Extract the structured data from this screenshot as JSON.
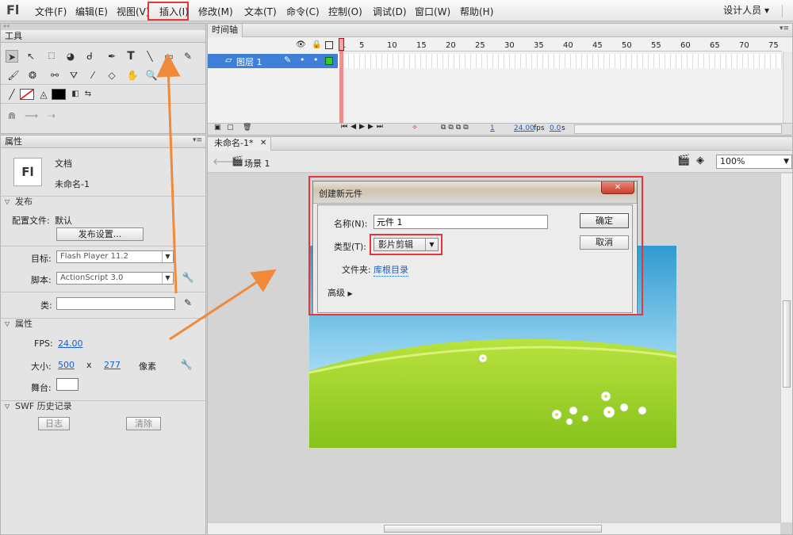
{
  "app": {
    "logo": "Fl",
    "workspace": "设计人员"
  },
  "menu": [
    "文件(F)",
    "编辑(E)",
    "视图(V)",
    "插入(I)",
    "修改(M)",
    "文本(T)",
    "命令(C)",
    "控制(O)",
    "调试(D)",
    "窗口(W)",
    "帮助(H)"
  ],
  "tools_panel": {
    "title": "工具"
  },
  "properties": {
    "title": "属性",
    "doc_type": "文档",
    "doc_name": "未命名-1",
    "doc_icon_text": "Fl",
    "publish_section": "发布",
    "profile_label": "配置文件:",
    "profile_value": "默认",
    "publish_settings_button": "发布设置...",
    "target_label": "目标:",
    "target_value": "Flash Player 11.2",
    "script_label": "脚本:",
    "script_value": "ActionScript 3.0",
    "class_label": "类:",
    "props_section": "属性",
    "fps_label": "FPS:",
    "fps_value": "24.00",
    "size_label": "大小:",
    "width_value": "500",
    "x_sep": "x",
    "height_value": "277",
    "unit": "像素",
    "stage_label": "舞台:",
    "swf_section": "SWF 历史记录",
    "log_button": "日志",
    "clear_button": "清除"
  },
  "timeline": {
    "tab": "时间轴",
    "layer_name": "图层 1",
    "frame_numbers": [
      "1",
      "5",
      "10",
      "15",
      "20",
      "25",
      "30",
      "35",
      "40",
      "45",
      "50",
      "55",
      "60",
      "65",
      "70",
      "75"
    ],
    "current_frame": "1",
    "fps": "24.00",
    "fps_unit": "fps",
    "time": "0.0",
    "time_unit": "s"
  },
  "document": {
    "tab": "未命名-1*",
    "scene": "场景 1",
    "zoom": "100%"
  },
  "dialog": {
    "title": "创建新元件",
    "name_label": "名称(N):",
    "name_value": "元件 1",
    "type_label": "类型(T):",
    "type_value": "影片剪辑",
    "folder_label": "文件夹:",
    "folder_value": "库根目录",
    "advanced": "高级",
    "ok_button": "确定",
    "cancel_button": "取消"
  },
  "colors": {
    "highlight_red": "#e8353a",
    "arrow_orange": "#f08a3a",
    "link_blue": "#1a5fc7",
    "playhead": "#e23b3b"
  }
}
